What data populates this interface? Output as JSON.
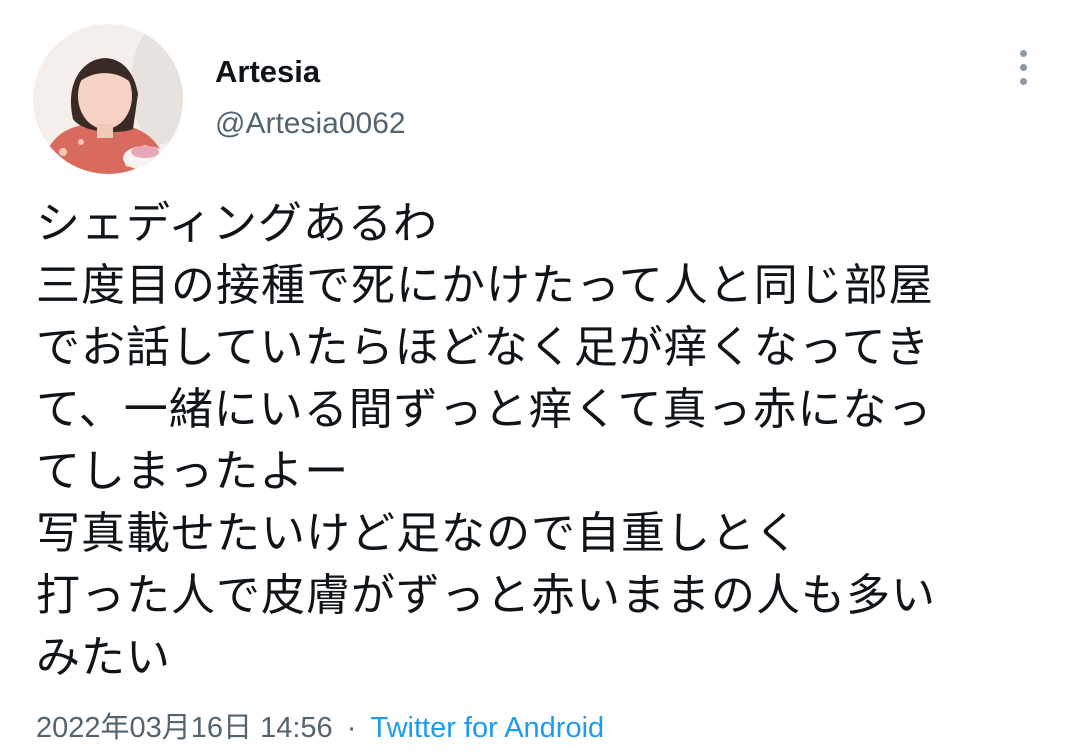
{
  "author": {
    "display_name": "Artesia",
    "handle": "@Artesia0062",
    "avatar_icon": "profile-photo"
  },
  "menu": {
    "icon": "more-vertical-icon"
  },
  "tweet": {
    "lines": [
      "シェディングあるわ",
      "三度目の接種で死にかけたって人と同じ部屋",
      "でお話していたらほどなく足が痒くなってき",
      "て、一緒にいる間ずっと痒くて真っ赤になっ",
      "てしまったよー",
      "写真載せたいけど足なので自重しとく",
      "打った人で皮膚がずっと赤いままの人も多い",
      "みたい"
    ]
  },
  "meta": {
    "timestamp": "2022年03月16日 14:56",
    "separator": "·",
    "source": "Twitter for Android"
  },
  "colors": {
    "text": "#0f1419",
    "secondary": "#536471",
    "link": "#1d9bf0"
  }
}
